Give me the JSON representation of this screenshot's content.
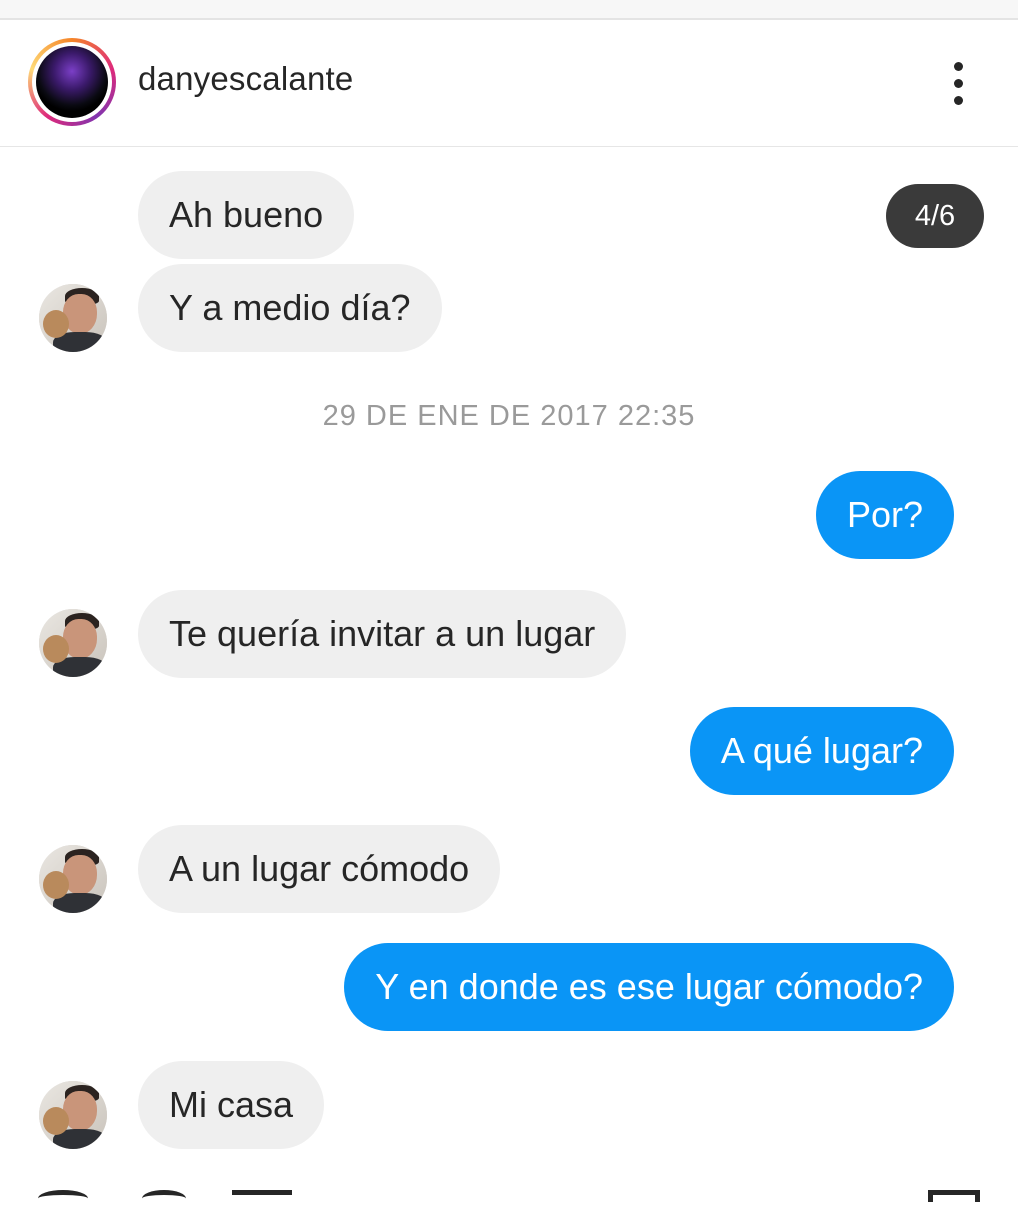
{
  "header": {
    "username": "danyescalante",
    "page_indicator": "4/6"
  },
  "timestamp": "29 DE ENE DE 2017 22:35",
  "messages": [
    {
      "sender": "other",
      "text": "Ah bueno"
    },
    {
      "sender": "other",
      "text": "Y a medio día?"
    },
    {
      "sender": "me",
      "text": "Por?"
    },
    {
      "sender": "other",
      "text": "Te quería invitar a un lugar"
    },
    {
      "sender": "me",
      "text": "A qué lugar?"
    },
    {
      "sender": "other",
      "text": "A un lugar cómodo"
    },
    {
      "sender": "me",
      "text": "Y en donde es ese lugar cómodo?"
    },
    {
      "sender": "other",
      "text": "Mi casa"
    }
  ],
  "icons": {
    "more": "more-vertical-icon",
    "profile": "profile-avatar",
    "sender_avatar": "sender-avatar"
  },
  "colors": {
    "outgoing_bubble": "#0a95f6",
    "incoming_bubble": "#efefef",
    "badge": "#3a3a3a"
  }
}
